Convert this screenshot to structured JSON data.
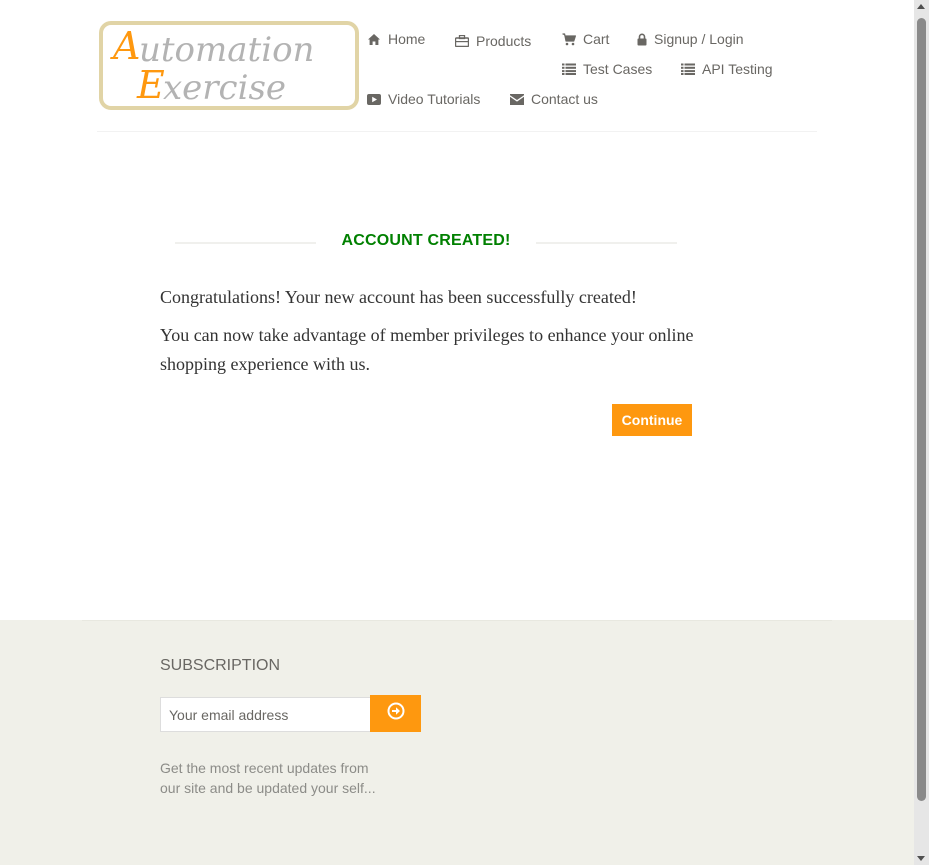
{
  "logo": {
    "line1": "Automation",
    "line2": "Exercise",
    "alt": "Website for automation practice"
  },
  "nav": {
    "home": "Home",
    "products": "Products",
    "cart": "Cart",
    "signup_login": "Signup / Login",
    "test_cases": "Test Cases",
    "api_testing": "API Testing",
    "video_tutorials": "Video Tutorials",
    "contact_us": "Contact us"
  },
  "main": {
    "title": "ACCOUNT CREATED!",
    "message_1": "Congratulations! Your new account has been successfully created!",
    "message_2": "You can now take advantage of member privileges to enhance your online shopping experience with us.",
    "continue_label": "Continue"
  },
  "footer": {
    "subscription_title": "SUBSCRIPTION",
    "email_placeholder": "Your email address",
    "description": "Get the most recent updates from our site and be updated your self..."
  },
  "icons": {
    "home": "home-icon",
    "products": "briefcase-icon",
    "cart": "shopping-cart-icon",
    "signup_login": "lock-icon",
    "test_cases": "list-icon",
    "api_testing": "list-icon",
    "video_tutorials": "youtube-play-icon",
    "contact_us": "envelope-icon",
    "subscribe": "arrow-circle-right-icon"
  },
  "colors": {
    "accent": "#fe980f",
    "success": "#008000",
    "nav_text": "#696763",
    "footer_bg": "#f0f0e9",
    "logo_orange": "#fe980f",
    "logo_gray": "#b3b3b3"
  }
}
